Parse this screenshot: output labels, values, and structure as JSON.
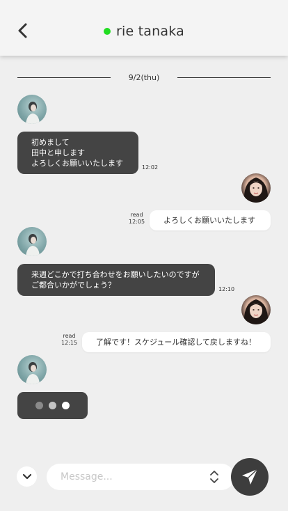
{
  "header": {
    "back_icon": "chevron-left-icon",
    "status_color": "#22dd22",
    "contact_name": "rie tanaka"
  },
  "chat": {
    "date_divider": "9/2(thu)",
    "messages": [
      {
        "from": "partner",
        "lines": [
          "初めまして",
          "田中と申します",
          "よろしくお願いいたします"
        ],
        "time": "12:02"
      },
      {
        "from": "me",
        "lines": [
          "よろしくお願いいたします"
        ],
        "status": "read",
        "time": "12:05"
      },
      {
        "from": "partner",
        "lines": [
          "来週どこかで打ち合わせをお願いしたいのですが",
          "ご都合いかがでしょう？"
        ],
        "time": "12:10"
      },
      {
        "from": "me",
        "lines": [
          "了解です！スケジュール確認して戻しますね！"
        ],
        "status": "read",
        "time": "12:15"
      }
    ],
    "typing_indicator": {
      "dot_colors": [
        "#8a8a8a",
        "#c4c4c4",
        "#ffffff"
      ]
    }
  },
  "composer": {
    "scroll_icon": "chevron-down-icon",
    "placeholder": "Message...",
    "value": "",
    "spin_icon": "up-down-chevron-icon",
    "send_icon": "send-arrow-icon"
  },
  "colors": {
    "background": "#efefef",
    "incoming_bubble": "#444444",
    "outgoing_bubble": "#ffffff",
    "send_button": "#3d3d3d"
  }
}
